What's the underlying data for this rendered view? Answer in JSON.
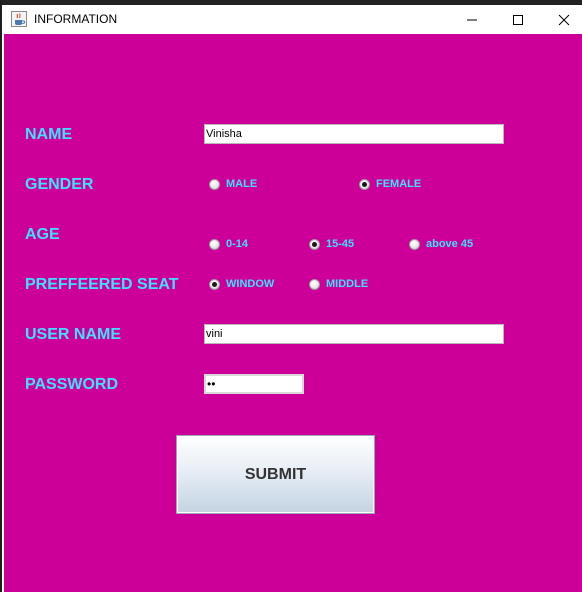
{
  "window": {
    "title": "INFORMATION",
    "icon": "java-cup-icon"
  },
  "colors": {
    "background": "#cc0099",
    "label": "#3ee0ff"
  },
  "form": {
    "name": {
      "label": "NAME",
      "value": "Vinisha"
    },
    "gender": {
      "label": "GENDER",
      "options": [
        {
          "label": "MALE",
          "selected": false
        },
        {
          "label": "FEMALE",
          "selected": true
        }
      ]
    },
    "age": {
      "label": "AGE",
      "options": [
        {
          "label": "0-14",
          "selected": false
        },
        {
          "label": "15-45",
          "selected": true
        },
        {
          "label": "above 45",
          "selected": false
        }
      ]
    },
    "seat": {
      "label": "PREFFEERED SEAT",
      "options": [
        {
          "label": "WINDOW",
          "selected": true
        },
        {
          "label": "MIDDLE",
          "selected": false
        }
      ]
    },
    "username": {
      "label": "USER NAME",
      "value": "vini"
    },
    "password": {
      "label": "PASSWORD",
      "value": "••"
    },
    "submit_label": "SUBMIT"
  }
}
